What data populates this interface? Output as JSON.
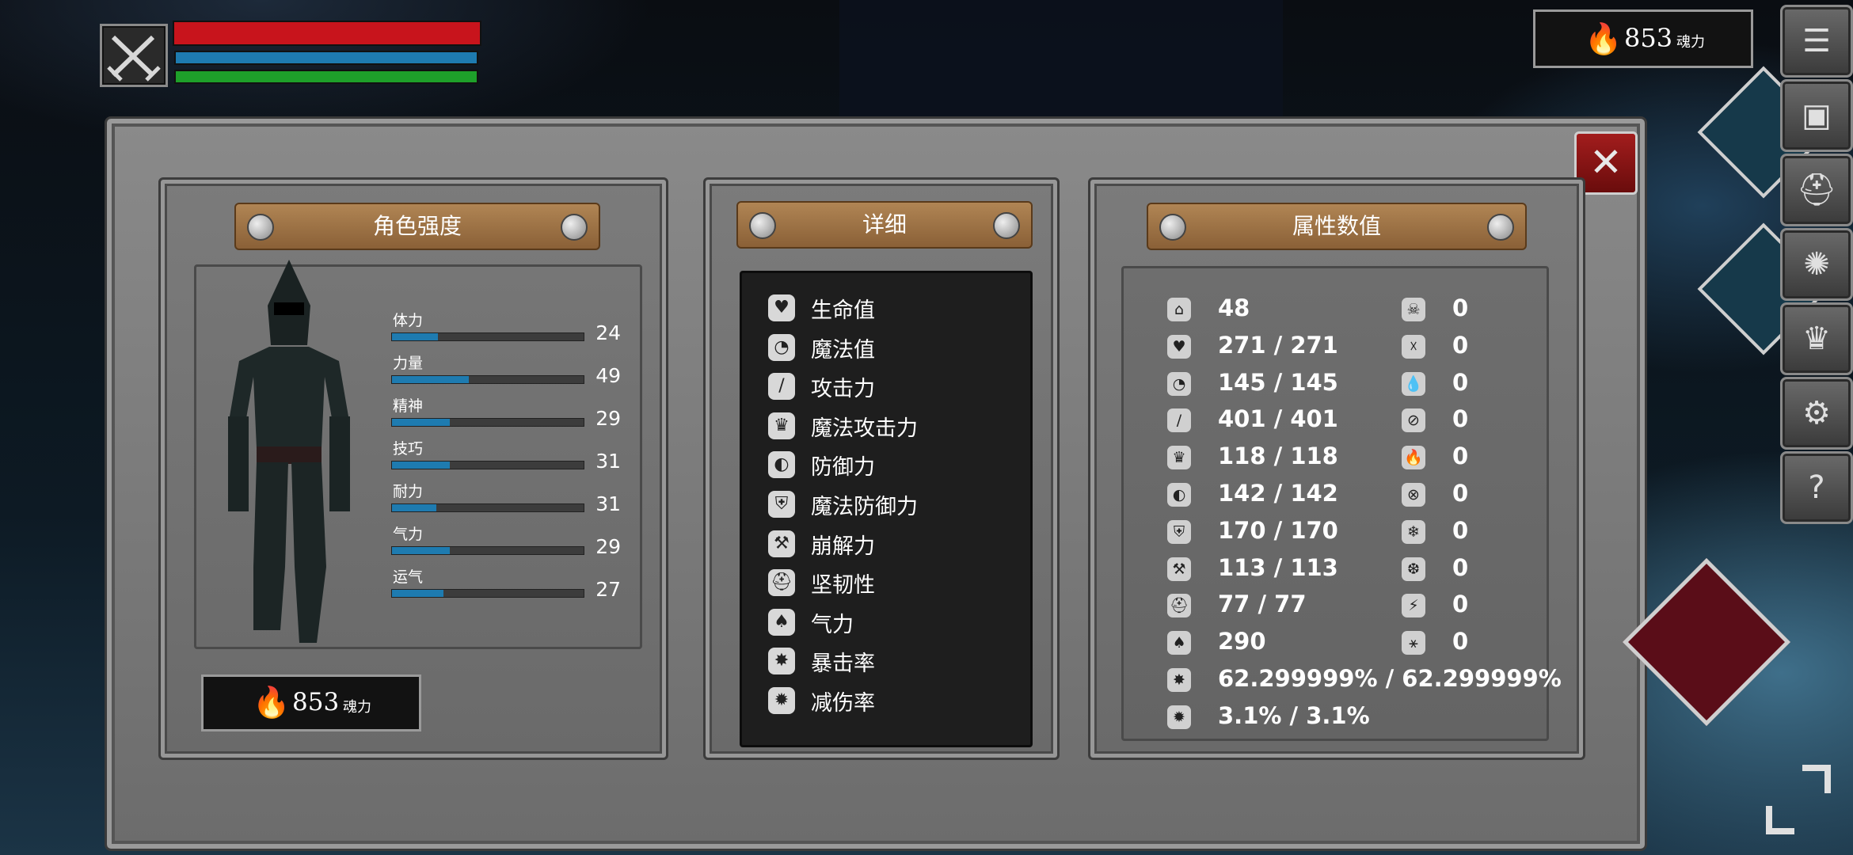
{
  "hud": {
    "hp_fill": 1.0,
    "mp_fill": 1.0,
    "stamina_fill": 1.0,
    "soul_count": "853",
    "soul_label": "魂力"
  },
  "colors": {
    "hp": "#c8141c",
    "mp": "#1e7bb0",
    "stamina": "#1ea02a"
  },
  "panel": {
    "character": {
      "title": "角色强度",
      "stats": [
        {
          "label": "体力",
          "value": "24",
          "fill": 0.24
        },
        {
          "label": "力量",
          "value": "49",
          "fill": 0.4
        },
        {
          "label": "精神",
          "value": "29",
          "fill": 0.3
        },
        {
          "label": "技巧",
          "value": "31",
          "fill": 0.3
        },
        {
          "label": "耐力",
          "value": "31",
          "fill": 0.23
        },
        {
          "label": "气力",
          "value": "29",
          "fill": 0.3
        },
        {
          "label": "运气",
          "value": "27",
          "fill": 0.27
        }
      ],
      "soul_count": "853",
      "soul_label": "魂力"
    },
    "details": {
      "title": "详细",
      "items": [
        {
          "icon": "heart-icon",
          "label": "生命值"
        },
        {
          "icon": "mind-icon",
          "label": "魔法值"
        },
        {
          "icon": "sword-icon",
          "label": "攻击力"
        },
        {
          "icon": "magic-crown-icon",
          "label": "魔法攻击力"
        },
        {
          "icon": "shield-icon",
          "label": "防御力"
        },
        {
          "icon": "magic-shield-icon",
          "label": "魔法防御力"
        },
        {
          "icon": "pickaxe-icon",
          "label": "崩解力"
        },
        {
          "icon": "helmet-icon",
          "label": "坚韧性"
        },
        {
          "icon": "lungs-icon",
          "label": "气力"
        },
        {
          "icon": "star-burst-icon",
          "label": "暴击率"
        },
        {
          "icon": "damage-reduce-icon",
          "label": "减伤率"
        }
      ]
    },
    "attributes": {
      "title": "属性数值",
      "left": [
        {
          "icon": "armor-icon",
          "value": "48"
        },
        {
          "icon": "heart-icon",
          "value": "271 / 271"
        },
        {
          "icon": "mind-icon",
          "value": "145 / 145"
        },
        {
          "icon": "sword-icon",
          "value": "401 / 401"
        },
        {
          "icon": "magic-crown-icon",
          "value": "118 / 118"
        },
        {
          "icon": "shield-icon",
          "value": "142 / 142"
        },
        {
          "icon": "magic-shield-icon",
          "value": "170 / 170"
        },
        {
          "icon": "pickaxe-icon",
          "value": "113 / 113"
        },
        {
          "icon": "helmet-icon",
          "value": "77 / 77"
        },
        {
          "icon": "lungs-icon",
          "value": "290"
        },
        {
          "icon": "star-burst-icon",
          "value": "62.299999% / 62.299999%"
        },
        {
          "icon": "damage-reduce-icon",
          "value": "3.1% / 3.1%"
        }
      ],
      "right": [
        {
          "icon": "poison-skull-icon",
          "value": "0"
        },
        {
          "icon": "poison-resist-icon",
          "value": "0"
        },
        {
          "icon": "bleed-icon",
          "value": "0"
        },
        {
          "icon": "bleed-resist-icon",
          "value": "0"
        },
        {
          "icon": "fire-icon",
          "value": "0"
        },
        {
          "icon": "fire-resist-icon",
          "value": "0"
        },
        {
          "icon": "frost-icon",
          "value": "0"
        },
        {
          "icon": "frost-resist-icon",
          "value": "0"
        },
        {
          "icon": "lightning-icon",
          "value": "0"
        },
        {
          "icon": "lightning-resist-icon",
          "value": "0"
        }
      ]
    }
  },
  "sidebar": [
    "menu-icon",
    "inventory-icon",
    "helmet-icon",
    "skill-rune-icon",
    "crown-icon",
    "gear-icon",
    "help-icon"
  ]
}
